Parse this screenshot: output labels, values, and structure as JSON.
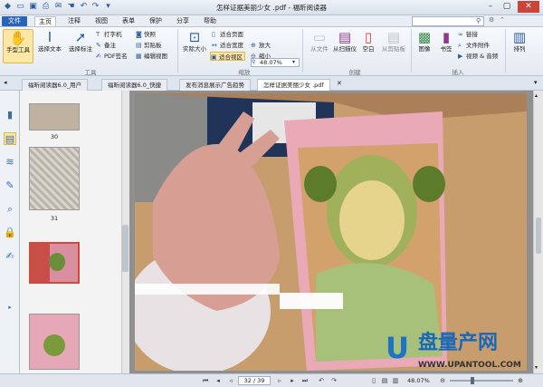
{
  "window": {
    "title": "怎样证据美丽少女 .pdf - 福昕阅读器"
  },
  "menu": [
    "文件",
    "主页",
    "注释",
    "视图",
    "表单",
    "保护",
    "分享",
    "帮助"
  ],
  "search": {
    "placeholder": ""
  },
  "ribbon": {
    "hand_tool": "手型工具",
    "select_text": "选择文本",
    "select_annot": "选择标注",
    "typewriter": "打字机",
    "note": "备注",
    "pdf_sign": "PDF签名",
    "snapshot": "快照",
    "clipboard": "剪贴板",
    "edit_view": "编辑视图",
    "actual_size": "实际大小",
    "fit_page": "适合页面",
    "fit_width": "适合宽度",
    "fit_visible": "适合视区",
    "zoom_value": "48.07%",
    "zoom_in": "放大",
    "zoom_out": "缩小",
    "from_file": "从文件",
    "from_scanner": "从扫描仪",
    "blank": "空白",
    "from_clipboard": "从剪贴板",
    "image": "图像",
    "bookmark": "书签",
    "link": "链接",
    "file_attachment": "文件附件",
    "video_audio": "视频 & 音频",
    "arrange": "排列",
    "group_tools": "工具",
    "group_zoom": "缩放",
    "group_create": "创建",
    "group_insert": "插入"
  },
  "tabs": [
    {
      "label": "福昕阅读器6.0_用户"
    },
    {
      "label": "福昕阅读器6.0_快捷"
    },
    {
      "label": "发布消息展示广告趋势"
    },
    {
      "label": "怎样证据美丽少女 .pdf"
    }
  ],
  "thumbs": {
    "p30": "30",
    "p31": "31"
  },
  "status": {
    "page": "32 / 39",
    "zoom": "48.07%"
  },
  "watermark": {
    "brand": "盘量产网",
    "url": "WWW.UPANTOOL.COM"
  },
  "colors": {
    "accent": "#2a64b8",
    "watermark": "#1b68b5"
  }
}
